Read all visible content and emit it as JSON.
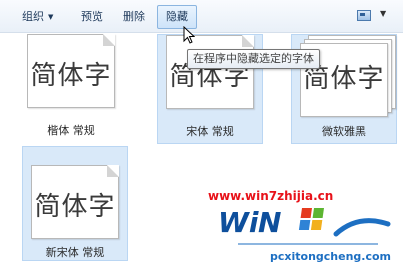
{
  "toolbar": {
    "organize": "组织",
    "preview": "预览",
    "delete": "删除",
    "hide": "隐藏"
  },
  "tooltip": "在程序中隐藏选定的字体",
  "fonts": [
    {
      "sample": "简体字",
      "name": "楷体 常规"
    },
    {
      "sample": "简体字",
      "name": "宋体 常规"
    },
    {
      "sample": "简体字",
      "name": "微软雅黑"
    },
    {
      "sample": "简体字",
      "name": "新宋体 常规"
    }
  ],
  "watermark": {
    "url": "www.win7zhijia.cn",
    "site": "pcxitongcheng.com"
  },
  "colors": {
    "selection": "#d9e9f9",
    "watermark_red": "#e8121a",
    "watermark_blue": "#1d6fc2"
  },
  "icons": [
    "dropdown-arrow-icon",
    "view-options-icon",
    "mouse-cursor-icon",
    "windows-logo-icon"
  ]
}
